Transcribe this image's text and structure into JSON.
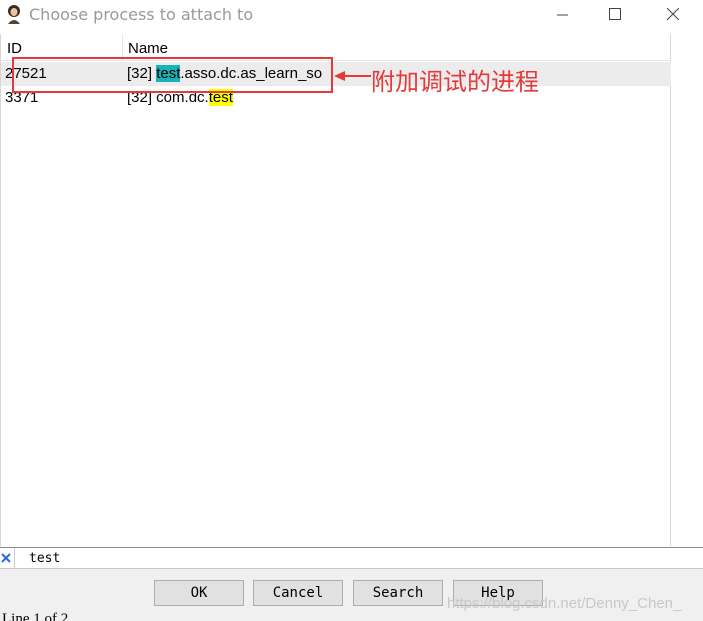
{
  "window": {
    "title": "Choose process to attach to",
    "minimize_label": "—",
    "maximize_label": "☐",
    "close_label": "✕"
  },
  "columns": {
    "id": "ID",
    "name": "Name"
  },
  "rows": [
    {
      "id": "27521",
      "name_prefix": "[32] ",
      "name_match": "test",
      "name_suffix": ".asso.dc.as_learn_so",
      "selected": true
    },
    {
      "id": "3371",
      "name_prefix": "[32] com.dc.",
      "name_match": "test",
      "name_suffix": "",
      "selected": false
    }
  ],
  "annotation": {
    "text": "附加调试的进程",
    "color": "#e53a3a"
  },
  "search": {
    "value": "test"
  },
  "buttons": {
    "ok": "OK",
    "cancel": "Cancel",
    "search": "Search",
    "help": "Help"
  },
  "watermark": "https://blog.csdn.net/Denny_Chen_",
  "status": "Line 1 of 2",
  "colors": {
    "highlight_current": "#17b3b8",
    "highlight_other": "#ffff00"
  }
}
